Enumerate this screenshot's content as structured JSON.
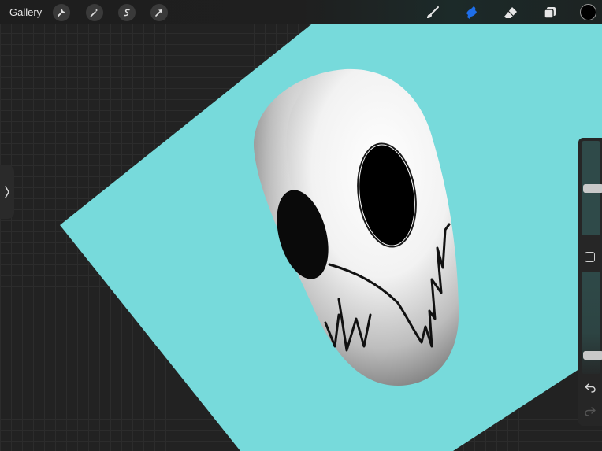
{
  "topbar": {
    "gallery_label": "Gallery",
    "left_tools": [
      "wrench-icon",
      "magic-wand-icon",
      "selection-icon",
      "transform-arrow-icon"
    ],
    "right_tools": [
      "brush-icon",
      "smudge-icon",
      "eraser-icon",
      "layers-icon"
    ],
    "active_tool": "smudge-icon",
    "active_color": "#000000",
    "accent_color": "#1e6ee8"
  },
  "sidebar": {
    "brush_size_level": 0.5,
    "opacity_level": 0.15
  },
  "canvas": {
    "background_color": "#77dadb"
  }
}
